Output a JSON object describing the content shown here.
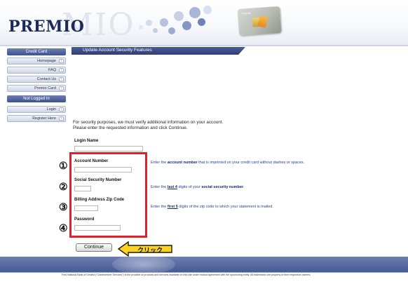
{
  "header": {
    "logo": "PREMIO",
    "logo_watermark": "MIO",
    "card_label": "Premio"
  },
  "sidebar": {
    "sections": [
      {
        "title": "Credit Card",
        "items": [
          "Homepage",
          "FAQ",
          "Contact Us",
          "Premio Card"
        ]
      },
      {
        "title": "Not Logged In",
        "items": [
          "Login",
          "Register Here"
        ]
      }
    ]
  },
  "main": {
    "title": "Update Account Security Features",
    "intro_line1": "For security purposes, we must verify additional information on your account.",
    "intro_line2": "Please enter the requested information and click Continue.",
    "login_name_label": "Login Name",
    "fields": [
      {
        "marker": "①",
        "label": "Account Number",
        "help_prefix": "Enter the ",
        "help_bold": "account number",
        "help_suffix": " that is imprinted on your credit card without dashes or spaces."
      },
      {
        "marker": "②",
        "label": "Social Security Number",
        "help_prefix": "Enter the ",
        "help_link": "last 4",
        "help_middle": " digits of your ",
        "help_bold": "social security number",
        "help_suffix": "."
      },
      {
        "marker": "③",
        "label": "Billing Address Zip Code",
        "help_prefix": "Enter the ",
        "help_link": "first 5",
        "help_suffix": " digits of the zip code to which your statement is mailed."
      },
      {
        "marker": "④",
        "label": "Password"
      }
    ],
    "continue_label": "Continue",
    "callout_label": "クリック"
  },
  "footer": {
    "text": "First National Bank of Omaha (\"Cardmember Services\") is the provider of products and services available on this site under mutual agreement with the sponsoring entity. All trademarks are property of their respective owners."
  },
  "colors": {
    "highlight": "#e0202a",
    "callout_fill": "#ffd21e",
    "nav_blue": "#3f5191"
  }
}
